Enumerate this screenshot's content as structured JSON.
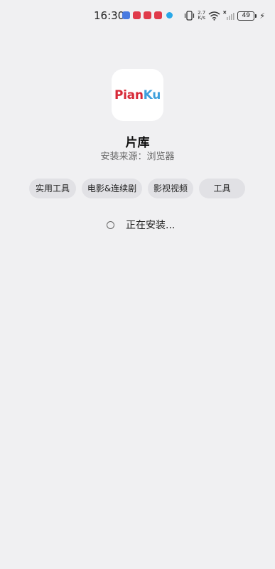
{
  "status_bar": {
    "time": "16:30",
    "network_speed_value": "2.7",
    "network_speed_unit": "K/s",
    "battery_level": "49",
    "icons": [
      "notification-blue-icon",
      "notification-red-icon",
      "notification-red-icon",
      "notification-red-icon",
      "app-notification-icon",
      "vibrate-icon",
      "wifi-icon",
      "no-signal-icon",
      "battery-icon",
      "charging-icon"
    ]
  },
  "app": {
    "logo_text_part1": "Pian",
    "logo_text_part2": "Ku",
    "name": "片库",
    "install_source": "安装来源：浏览器"
  },
  "tags": [
    "实用工具",
    "电影&连续剧",
    "影视视频",
    "工具"
  ],
  "status": {
    "message": "正在安装..."
  },
  "colors": {
    "background": "#f0f0f2",
    "tag_background": "#e1e1e5",
    "logo_red": "#d72a38",
    "logo_blue": "#3ea0dc"
  }
}
